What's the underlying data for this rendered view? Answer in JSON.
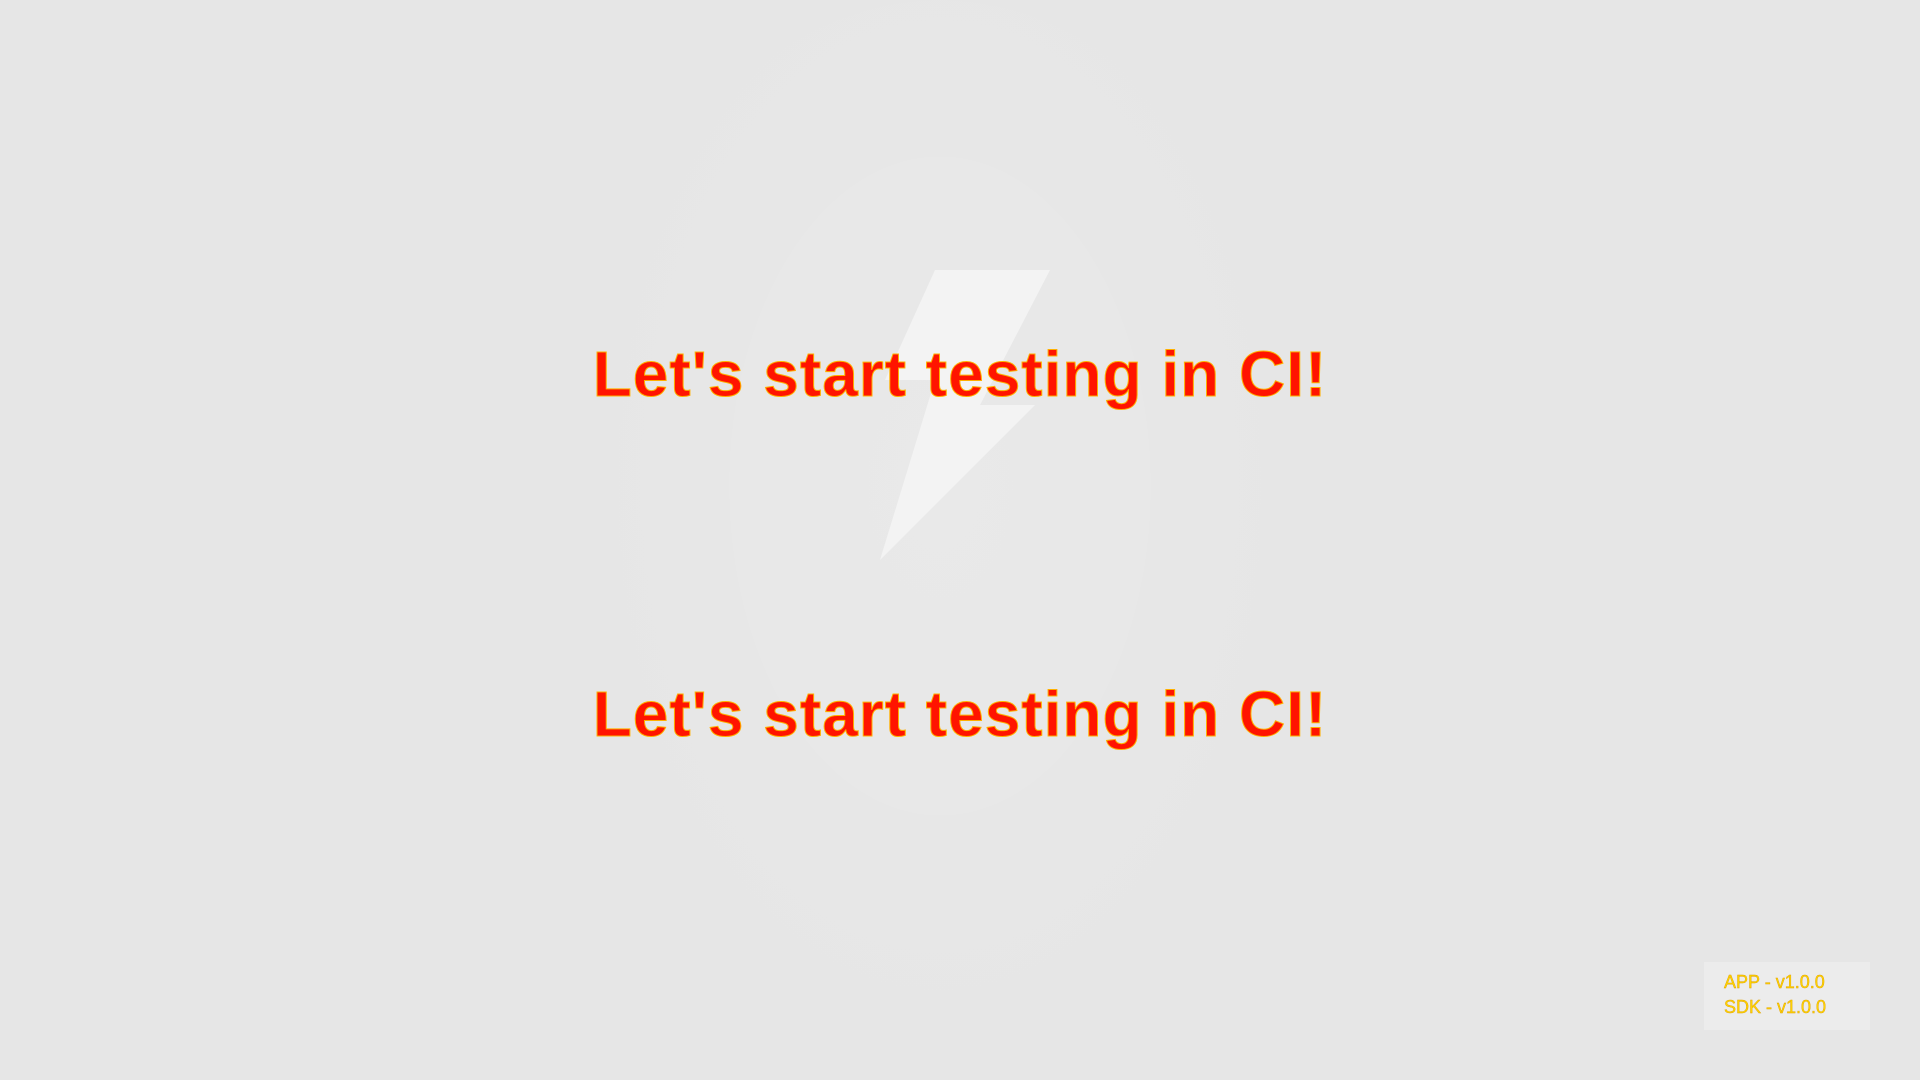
{
  "screen": {
    "headline_top": "Let's start testing in CI!",
    "headline_bottom": "Let's start testing in CI!",
    "logo_icon": "lightning-bolt-icon"
  },
  "version_info": {
    "app": "APP - v1.0.0",
    "sdk": "SDK - v1.0.0"
  },
  "colors": {
    "background": "#e6e6e6",
    "headline": "#ff1400",
    "headline_outline": "#ffb000",
    "version_text": "#ffd500",
    "bolt": "#f3f3f3"
  }
}
